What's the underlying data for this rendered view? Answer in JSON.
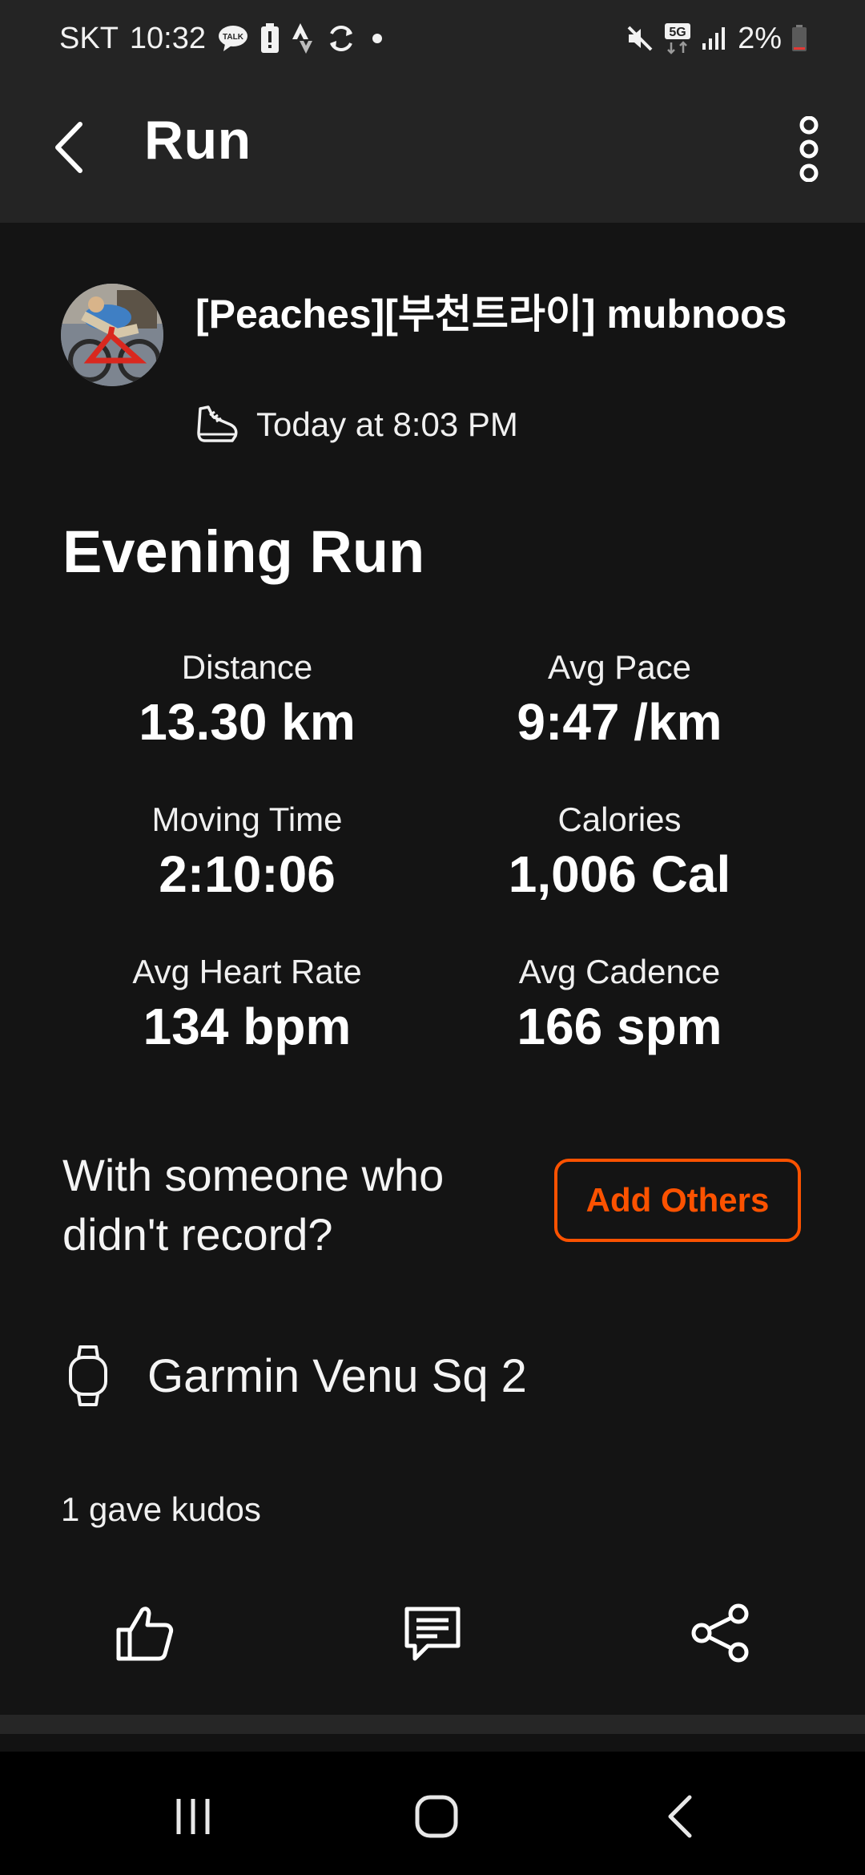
{
  "status_bar": {
    "carrier": "SKT",
    "time": "10:32",
    "network": "5G",
    "battery": "2%"
  },
  "app_bar": {
    "title": "Run"
  },
  "athlete": {
    "name": "[Peaches][부천트라이] mubnoos",
    "timestamp": "Today at 8:03 PM"
  },
  "activity": {
    "title": "Evening Run",
    "stats": [
      {
        "label": "Distance",
        "value": "13.30 km"
      },
      {
        "label": "Avg Pace",
        "value": "9:47 /km"
      },
      {
        "label": "Moving Time",
        "value": "2:10:06"
      },
      {
        "label": "Calories",
        "value": "1,006 Cal"
      },
      {
        "label": "Avg Heart Rate",
        "value": "134 bpm"
      },
      {
        "label": "Avg Cadence",
        "value": "166 spm"
      }
    ]
  },
  "with_others": {
    "prompt": "With someone who didn't record?",
    "button_label": "Add Others"
  },
  "device": {
    "name": "Garmin Venu Sq 2"
  },
  "kudos": {
    "text": "1 gave kudos"
  },
  "icons": {
    "back": "chevron-left-icon",
    "overflow": "vertical-dots-icon",
    "shoe": "running-shoe-icon",
    "watch": "watch-icon",
    "kudos": "thumbs-up-icon",
    "comment": "comment-icon",
    "share": "share-icon"
  },
  "colors": {
    "accent": "#fc5200",
    "background": "#141414",
    "app_bar": "#242424"
  }
}
